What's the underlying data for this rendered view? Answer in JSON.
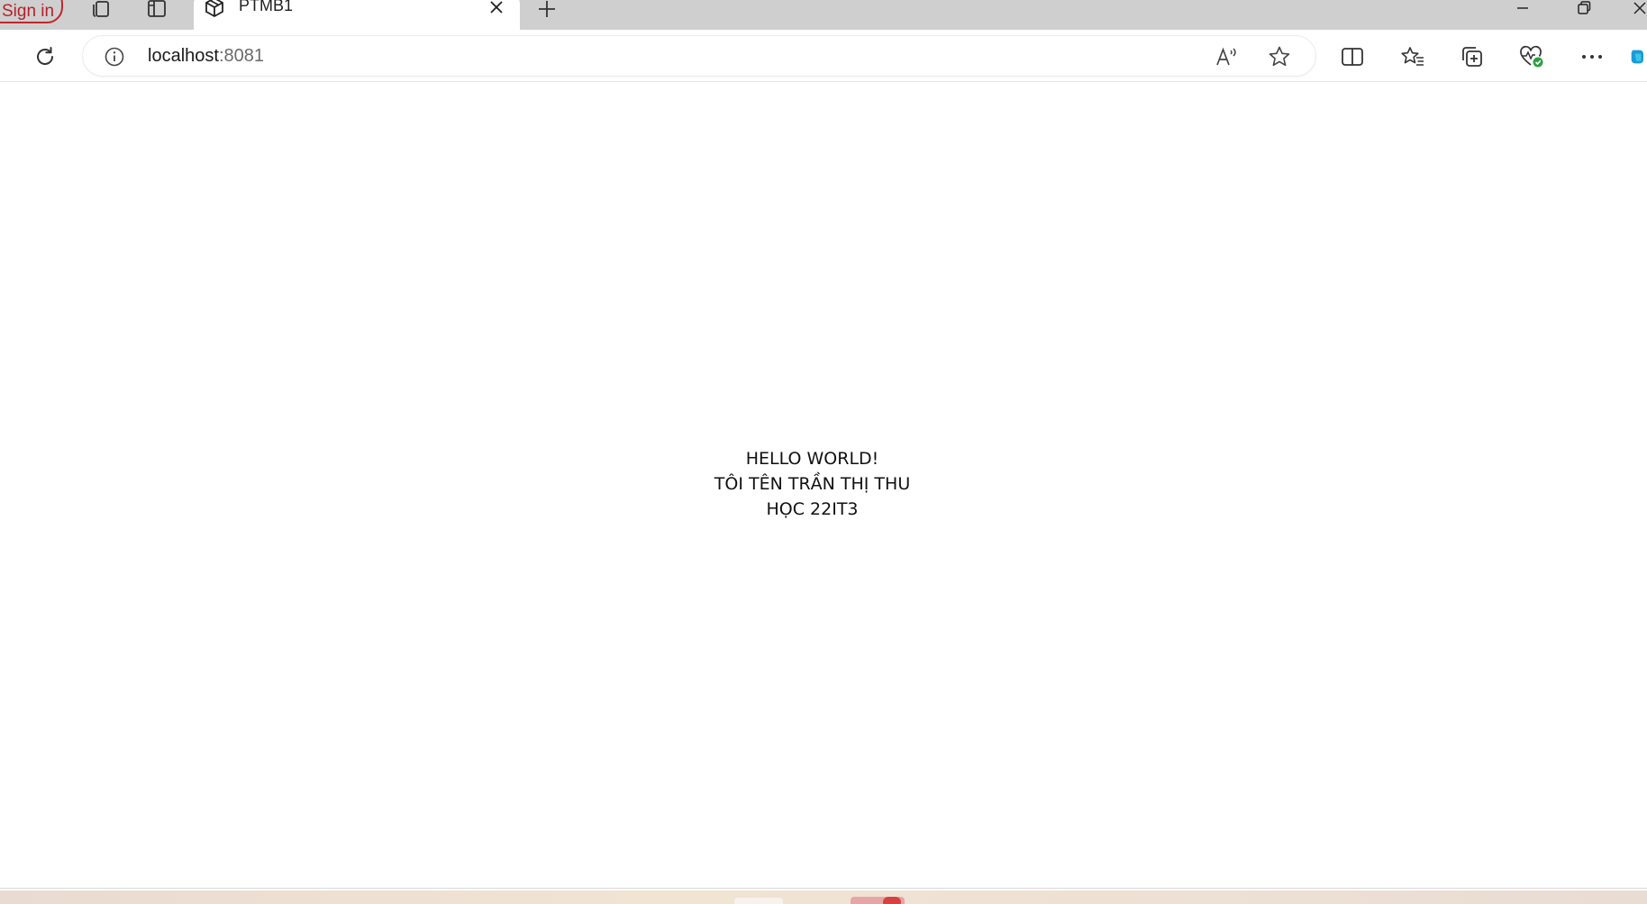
{
  "browser": {
    "sign_in_label": "Sign in",
    "tab": {
      "title": "PTMB1",
      "favicon": "codesandbox-cube-icon"
    },
    "address": {
      "host": "localhost",
      "port": ":8081"
    },
    "icons": {
      "workspaces": "workspaces-icon",
      "vertical_tabs": "vertical-tabs-icon",
      "new_tab": "plus-icon",
      "minimize": "minimize-icon",
      "restore": "restore-icon",
      "close_window": "close-icon",
      "refresh": "refresh-icon",
      "site_info": "info-icon",
      "read_aloud": "read-aloud-icon",
      "favorite": "star-icon",
      "split_screen": "split-screen-icon",
      "favorites": "favorites-icon",
      "collections": "collections-icon",
      "browser_essentials": "heart-pulse-icon",
      "more": "more-icon",
      "copilot": "copilot-icon"
    }
  },
  "page": {
    "lines": [
      "HELLO WORLD!",
      "TÔI TÊN TRẦN THỊ THU",
      "HỌC 22IT3"
    ]
  },
  "colors": {
    "tabstrip_bg": "#cfcfcf",
    "sign_in_accent": "#c0262d",
    "status_green": "#2e9e44",
    "copilot_blue": "#1a9bd7"
  }
}
